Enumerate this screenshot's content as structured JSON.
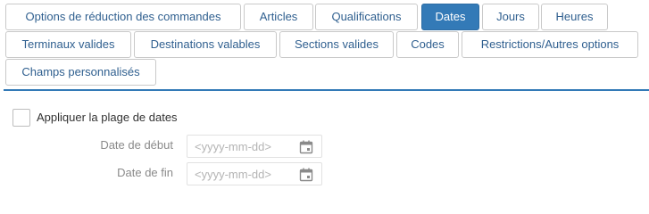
{
  "tabs": [
    {
      "label": "Options de réduction des commandes",
      "active": false
    },
    {
      "label": "Articles",
      "active": false
    },
    {
      "label": "Qualifications",
      "active": false
    },
    {
      "label": "Dates",
      "active": true
    },
    {
      "label": "Jours",
      "active": false
    },
    {
      "label": "Heures",
      "active": false
    },
    {
      "label": "Terminaux valides",
      "active": false
    },
    {
      "label": "Destinations valables",
      "active": false
    },
    {
      "label": "Sections valides",
      "active": false
    },
    {
      "label": "Codes",
      "active": false
    },
    {
      "label": "Restrictions/Autres options",
      "active": false
    },
    {
      "label": "Champs personnalisés",
      "active": false
    }
  ],
  "dates_panel": {
    "apply_label": "Appliquer la plage de dates",
    "apply_checked": false,
    "start": {
      "label": "Date de début",
      "value": "",
      "placeholder": "<yyyy-mm-dd>"
    },
    "end": {
      "label": "Date de fin",
      "value": "",
      "placeholder": "<yyyy-mm-dd>"
    }
  },
  "colors": {
    "accent": "#337ab7",
    "tab_text": "#2f5f8f",
    "border": "#c9c9c9"
  },
  "icons": {
    "date_picker": "calendar-icon"
  }
}
